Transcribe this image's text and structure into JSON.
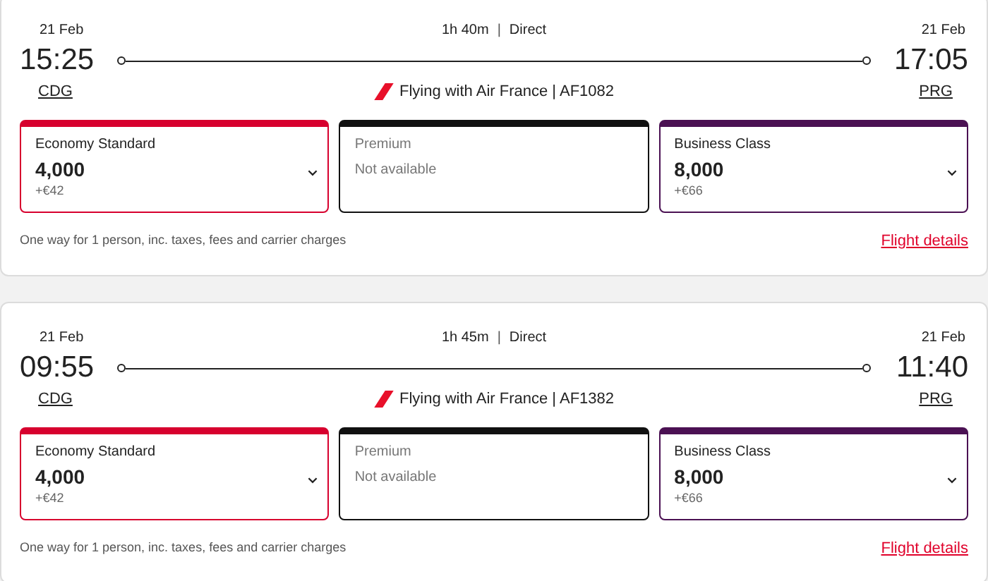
{
  "flights": [
    {
      "departure_date": "21 Feb",
      "duration": "1h 40m",
      "separator": "|",
      "stops": "Direct",
      "arrival_date": "21 Feb",
      "departure_time": "15:25",
      "arrival_time": "17:05",
      "origin": "CDG",
      "destination": "PRG",
      "operator": "Flying with Air France | AF1082",
      "fares": [
        {
          "kind": "available",
          "color": "#d7002e",
          "cabin": "Economy Standard",
          "points": "4,000",
          "surcharge": "+€42"
        },
        {
          "kind": "unavailable",
          "color": "#111111",
          "cabin": "Premium",
          "status": "Not available"
        },
        {
          "kind": "available",
          "color": "#4b1153",
          "cabin": "Business Class",
          "points": "8,000",
          "surcharge": "+€66"
        }
      ],
      "note": "One way for 1 person, inc. taxes, fees and carrier charges",
      "details_link": "Flight details"
    },
    {
      "departure_date": "21 Feb",
      "duration": "1h 45m",
      "separator": "|",
      "stops": "Direct",
      "arrival_date": "21 Feb",
      "departure_time": "09:55",
      "arrival_time": "11:40",
      "origin": "CDG",
      "destination": "PRG",
      "operator": "Flying with Air France | AF1382",
      "fares": [
        {
          "kind": "available",
          "color": "#d7002e",
          "cabin": "Economy Standard",
          "points": "4,000",
          "surcharge": "+€42"
        },
        {
          "kind": "unavailable",
          "color": "#111111",
          "cabin": "Premium",
          "status": "Not available"
        },
        {
          "kind": "available",
          "color": "#4b1153",
          "cabin": "Business Class",
          "points": "8,000",
          "surcharge": "+€66"
        }
      ],
      "note": "One way for 1 person, inc. taxes, fees and carrier charges",
      "details_link": "Flight details"
    }
  ]
}
